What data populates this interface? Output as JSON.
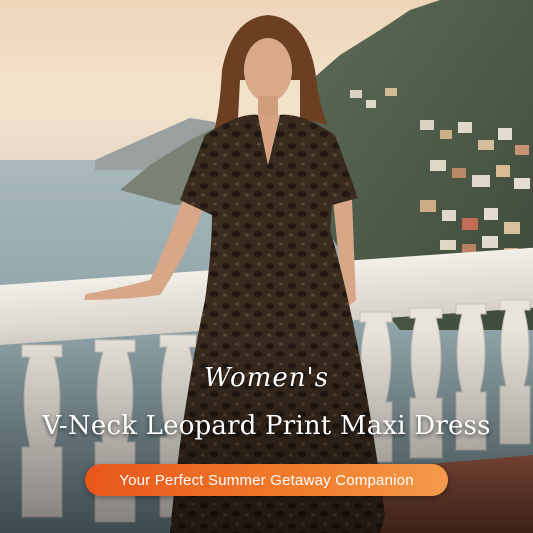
{
  "overlay": {
    "script_word": "Women's",
    "product_title": "V-Neck Leopard Print Maxi Dress",
    "tagline": "Your Perfect Summer Getaway Companion"
  },
  "colors": {
    "pill_start": "#e8561c",
    "pill_end": "#f39a4a",
    "dress": "#3a2b1f",
    "sky": "#f1dcc1",
    "sea": "#8fa6ad"
  }
}
